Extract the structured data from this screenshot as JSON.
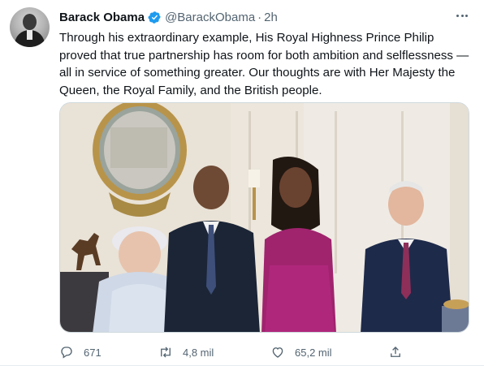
{
  "tweet": {
    "author_name": "Barack Obama",
    "author_handle": "@BarackObama",
    "separator": "·",
    "time": "2h",
    "text": "Through his extraordinary example, His Royal Highness Prince Philip proved that true partnership has room for both ambition and selflessness — all in service of something greater. Our thoughts are with Her Majesty the Queen, the Royal Family, and the British people.",
    "verified": true
  },
  "actions": {
    "reply_count": "671",
    "retweet_count": "4,8 mil",
    "like_count": "65,2 mil"
  },
  "icons": {
    "verified": "verified-badge-icon",
    "more": "more-options-icon",
    "reply": "reply-icon",
    "retweet": "retweet-icon",
    "like": "heart-icon",
    "share": "share-icon"
  },
  "colors": {
    "text": "#0f1419",
    "secondary": "#536471",
    "verified": "#1d9bf0",
    "border": "#cfd9de"
  }
}
